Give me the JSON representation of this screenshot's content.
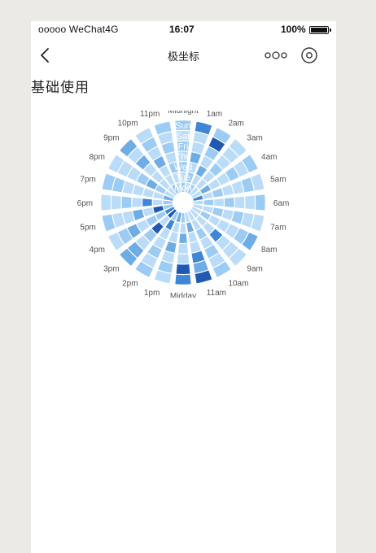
{
  "status_bar": {
    "carrier": "ooooo WeChat4G",
    "time": "16:07",
    "battery": "100%"
  },
  "nav": {
    "title": "极坐标"
  },
  "section_title": "基础使用",
  "icons": {
    "back": "chevron-left-icon",
    "more": "more-dots-icon",
    "close": "target-close-icon",
    "battery": "battery-icon"
  },
  "colors": {
    "level_1": "#bbdcf9",
    "level_2": "#9ccbf3",
    "level_3": "#6eace6",
    "level_4": "#3f86d6",
    "level_5": "#1f59b3",
    "ring_label": "#ffffff",
    "hour_label": "#555555"
  },
  "chart_data": {
    "type": "heatmap",
    "coordinate": "polar",
    "hours": [
      "Midnight",
      "1am",
      "2am",
      "3am",
      "4am",
      "5am",
      "6am",
      "7am",
      "8am",
      "9am",
      "10am",
      "11am",
      "Midday",
      "1pm",
      "2pm",
      "3pm",
      "4pm",
      "5pm",
      "6pm",
      "7pm",
      "8pm",
      "9pm",
      "10pm",
      "11pm"
    ],
    "days": [
      "Mon",
      "Tue",
      "Wed",
      "Thu",
      "Fri",
      "Sat",
      "Sun"
    ],
    "levels": [
      [
        2,
        1,
        2,
        1,
        1,
        4,
        1,
        1,
        1,
        1,
        1,
        1,
        2,
        3,
        2,
        5,
        4,
        2,
        2,
        3,
        1,
        1,
        2,
        1
      ],
      [
        1,
        2,
        1,
        1,
        3,
        1,
        2,
        1,
        2,
        1,
        1,
        3,
        1,
        1,
        4,
        1,
        2,
        5,
        1,
        1,
        2,
        1,
        1,
        1
      ],
      [
        2,
        1,
        3,
        1,
        1,
        2,
        1,
        2,
        1,
        1,
        2,
        1,
        3,
        1,
        1,
        5,
        2,
        1,
        4,
        1,
        3,
        1,
        1,
        2
      ],
      [
        1,
        3,
        1,
        2,
        1,
        1,
        2,
        1,
        1,
        4,
        1,
        1,
        1,
        3,
        1,
        2,
        1,
        3,
        1,
        1,
        2,
        1,
        3,
        1
      ],
      [
        2,
        1,
        2,
        1,
        2,
        1,
        1,
        2,
        1,
        1,
        2,
        4,
        1,
        1,
        2,
        1,
        3,
        1,
        2,
        1,
        1,
        3,
        1,
        2
      ],
      [
        1,
        1,
        5,
        1,
        1,
        2,
        1,
        1,
        2,
        1,
        1,
        3,
        5,
        2,
        1,
        3,
        2,
        1,
        1,
        2,
        1,
        1,
        2,
        1
      ],
      [
        2,
        4,
        2,
        1,
        2,
        1,
        2,
        1,
        3,
        1,
        2,
        5,
        4,
        1,
        2,
        3,
        1,
        2,
        1,
        2,
        1,
        3,
        1,
        2
      ]
    ]
  }
}
